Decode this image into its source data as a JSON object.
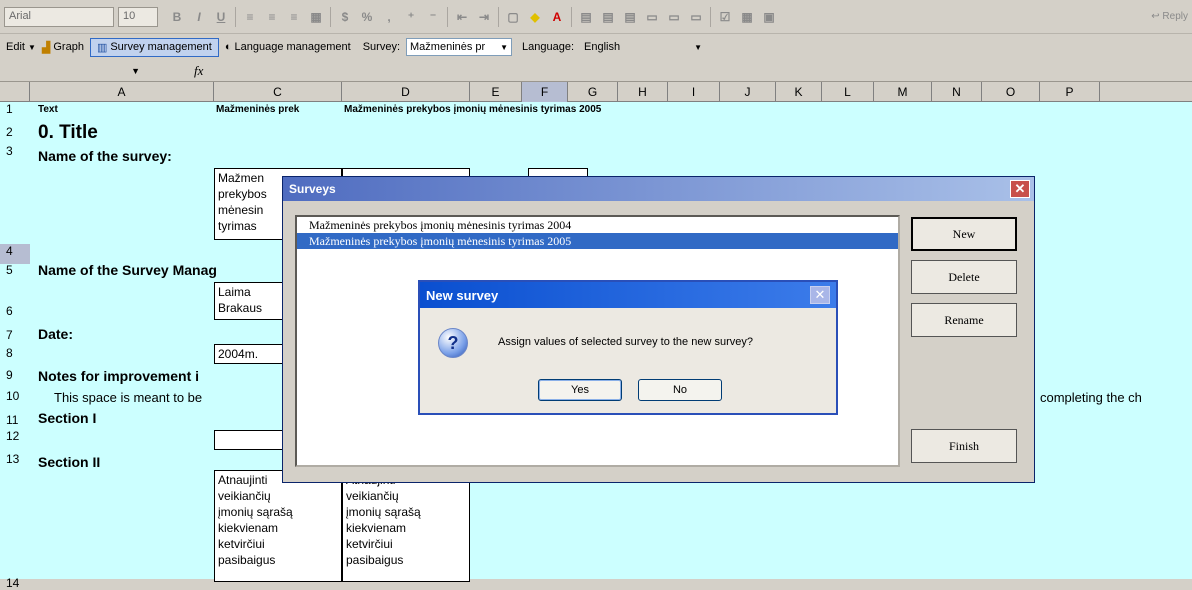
{
  "toolbar": {
    "font_name": "Arial",
    "font_size": "10",
    "reply": "Reply"
  },
  "toolbar2": {
    "edit": "Edit",
    "graph": "Graph",
    "survey_management": "Survey management",
    "language_management": "Language management",
    "survey_label": "Survey:",
    "survey_value": "Mažmeninės pr",
    "language_label": "Language:",
    "language_value": "English"
  },
  "formula_bar": {
    "fx": "fx"
  },
  "columns": [
    "A",
    "C",
    "D",
    "E",
    "F",
    "G",
    "H",
    "I",
    "J",
    "K",
    "L",
    "M",
    "N",
    "O",
    "P"
  ],
  "rows": [
    "1",
    "2",
    "3",
    "4",
    "5",
    "6",
    "7",
    "8",
    "9",
    "10",
    "11",
    "12",
    "13",
    "14"
  ],
  "cells": {
    "r1_a": "Text",
    "r1_c": "Mažmeninės prek",
    "r1_d": "Mažmeninės prekybos įmonių mėnesinis tyrimas 2005",
    "r2_a": "0. Title",
    "r3_a": "Name of the survey:",
    "r4_c": "Mažmen\nprekybos\nmėnesin\ntyrimas",
    "r5_a": "Name of the Survey Manag",
    "r6_c": "Laima\nBrakaus",
    "r7_a": "Date:",
    "r8_c": "2004m.",
    "r9_a": "Notes for improvement i",
    "r10_a": "This space is meant to be",
    "r10_right": "completing the ch",
    "r11_a": "Section I",
    "r13_a": "Section II",
    "r14_c": "Atnaujinti\nveikiančių\nįmonių sąrašą\nkiekvienam\nketvirčiui\npasibaigus",
    "r14_d": "Atnaujinti\nveikiančių\nįmonių sąrašą\nkiekvienam\nketvirčiui\npasibaigus"
  },
  "surveys_dialog": {
    "title": "Surveys",
    "items": [
      "Mažmeninės prekybos įmonių mėnesinis tyrimas 2004",
      "Mažmeninės prekybos įmonių mėnesinis tyrimas 2005"
    ],
    "selected_index": 1,
    "buttons": {
      "new": "New",
      "delete": "Delete",
      "rename": "Rename",
      "finish": "Finish"
    }
  },
  "new_survey_dialog": {
    "title": "New survey",
    "message": "Assign values of selected survey to the new survey?",
    "yes": "Yes",
    "no": "No"
  }
}
